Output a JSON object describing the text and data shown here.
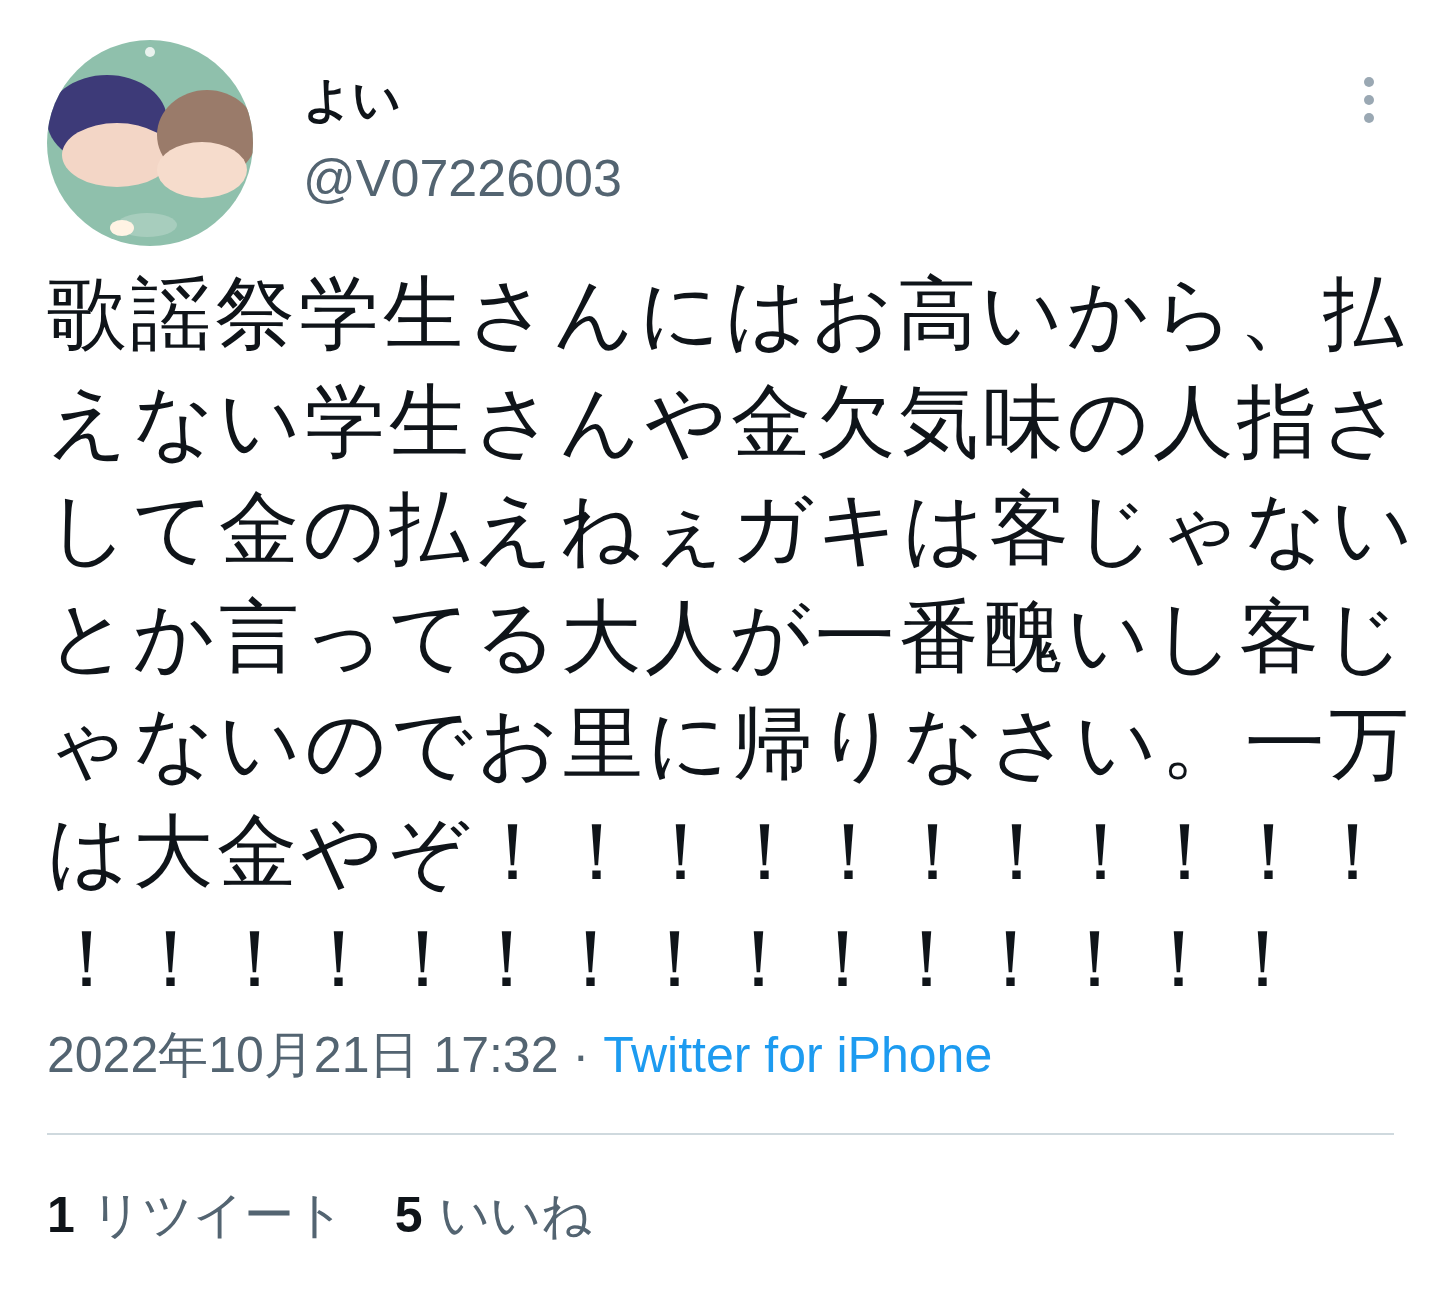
{
  "author": {
    "display_name": "よい",
    "handle": "@V07226003"
  },
  "tweet_text": "歌謡祭学生さんにはお高いから、払えない学生さんや金欠気味の人指さして金の払えねぇガキは客じゃないとか言ってる大人が一番醜いし客じゃないのでお里に帰りなさい。一万は大金やぞ！！！！！！！！！！！！！！！！！！！！！！！！！！",
  "timestamp": "2022年10月21日 17:32",
  "separator": "·",
  "source": "Twitter for iPhone",
  "stats": [
    {
      "count": "1",
      "label": "リツイート"
    },
    {
      "count": "5",
      "label": "いいね"
    }
  ]
}
